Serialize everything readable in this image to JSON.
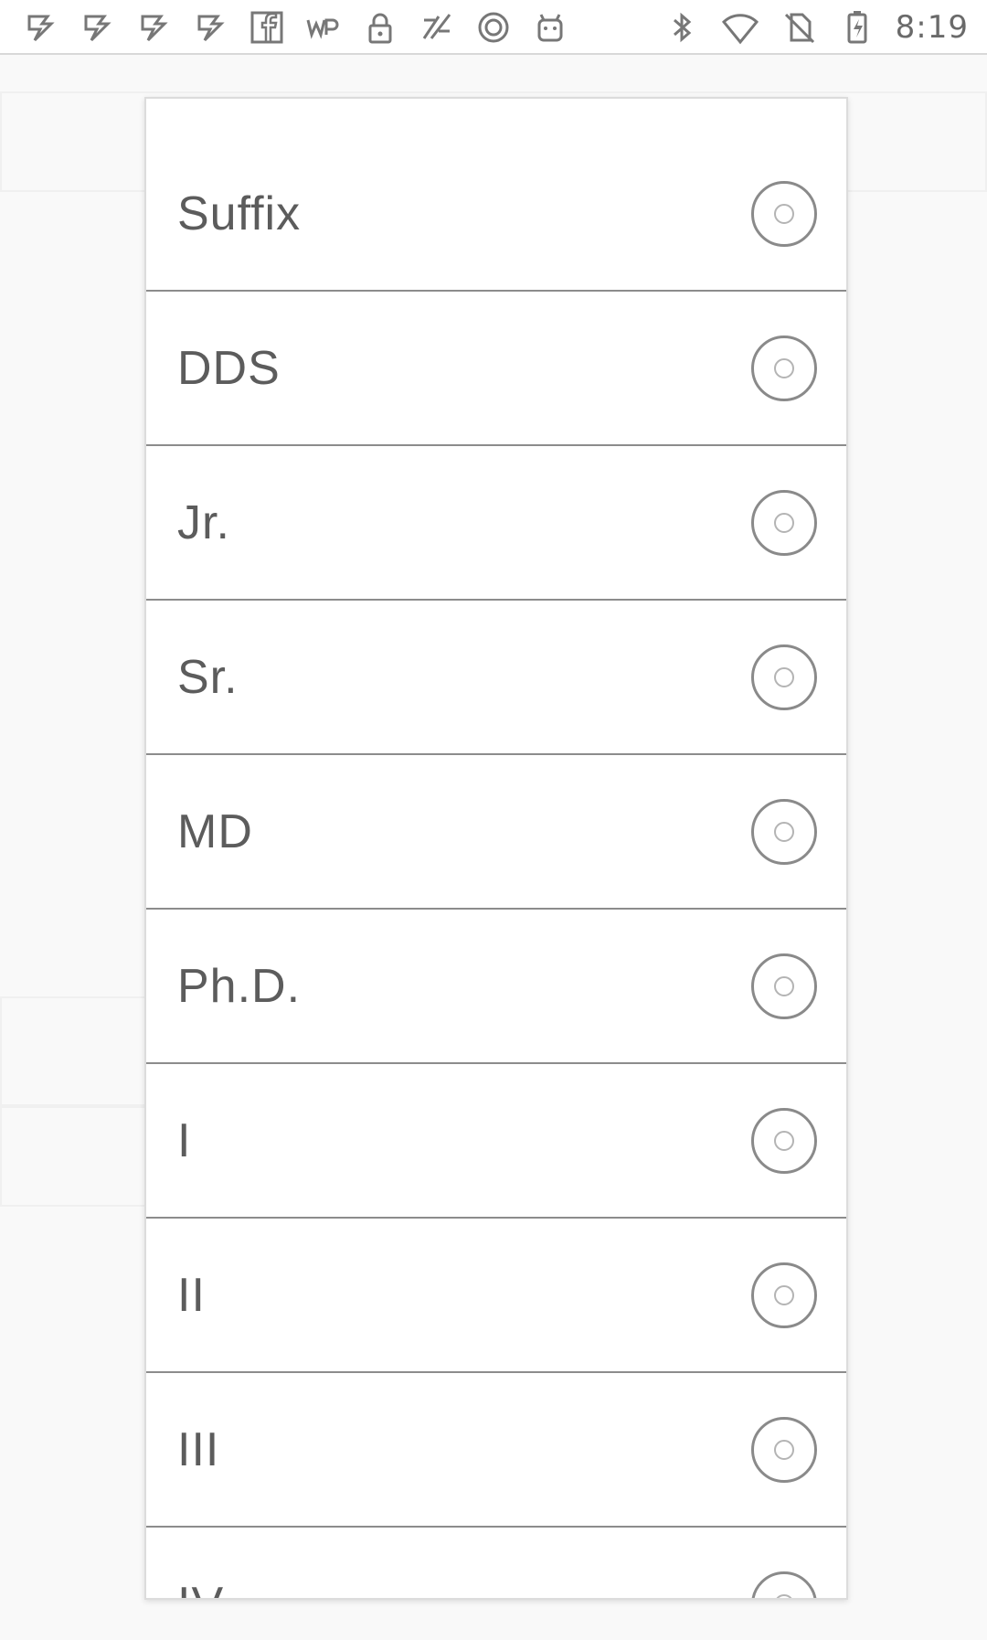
{
  "status_bar": {
    "left_icons": [
      "app-notification-icon",
      "app-notification-icon",
      "app-notification-icon",
      "app-notification-icon",
      "facebook-icon",
      "washington-post-icon",
      "lock-icon",
      "sports-app-icon",
      "app-circle-icon",
      "android-icon"
    ],
    "right_icons": [
      "bluetooth-icon",
      "wifi-icon",
      "no-sim-icon",
      "battery-charging-icon"
    ],
    "time": "8:19"
  },
  "dialog": {
    "options": [
      {
        "label": "Suffix"
      },
      {
        "label": "DDS"
      },
      {
        "label": "Jr."
      },
      {
        "label": "Sr."
      },
      {
        "label": "MD"
      },
      {
        "label": "Ph.D."
      },
      {
        "label": "I"
      },
      {
        "label": "II"
      },
      {
        "label": "III"
      },
      {
        "label": "IV"
      }
    ]
  },
  "colors": {
    "divider": "#8c8c8c",
    "label": "#5c5c5c",
    "radio": "#8a8a8a"
  }
}
